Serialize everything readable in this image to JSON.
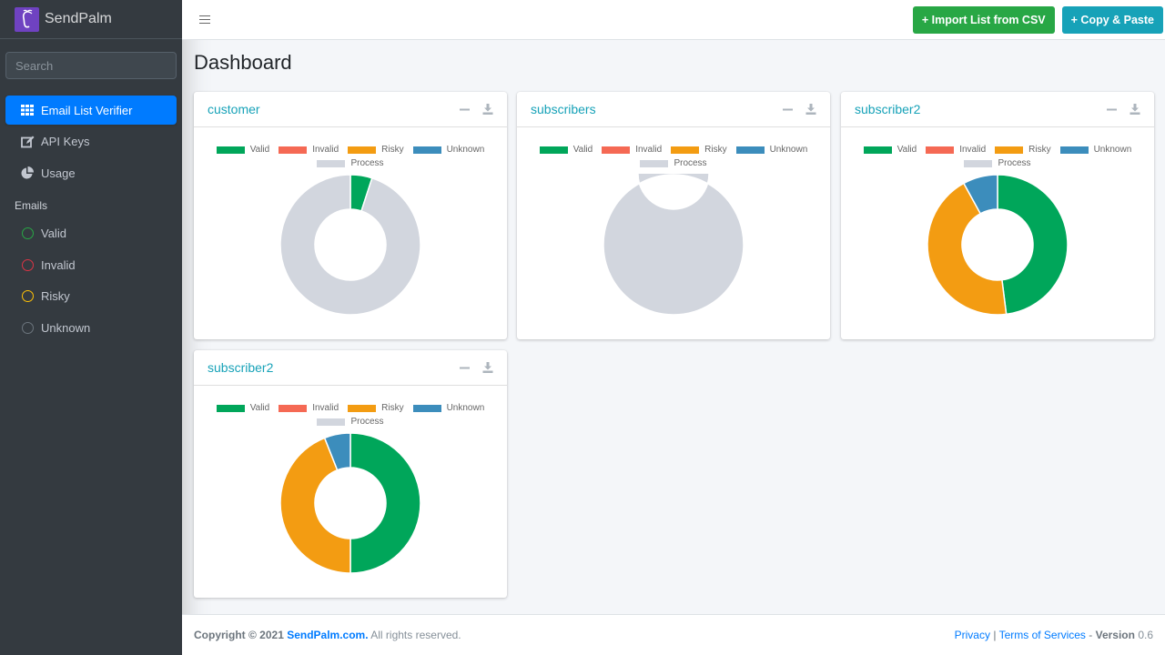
{
  "brand": {
    "name": "SendPalm",
    "logo_icon": "palm-logo-icon"
  },
  "search": {
    "placeholder": "Search",
    "value": ""
  },
  "sidebar": {
    "items": [
      {
        "label": "Email List Verifier",
        "icon": "grid-icon",
        "active": true
      },
      {
        "label": "API Keys",
        "icon": "edit-icon",
        "active": false
      },
      {
        "label": "Usage",
        "icon": "pie-chart-icon",
        "active": false
      }
    ],
    "section_header": "Emails",
    "email_items": [
      {
        "label": "Valid",
        "color": "#28a745"
      },
      {
        "label": "Invalid",
        "color": "#dc3545"
      },
      {
        "label": "Risky",
        "color": "#ffc107"
      },
      {
        "label": "Unknown",
        "color": "#6c757d"
      }
    ]
  },
  "topbar": {
    "import_label": "+ Import List from CSV",
    "copy_paste_label": "+ Copy & Paste"
  },
  "page": {
    "title": "Dashboard"
  },
  "legend": {
    "labels": [
      "Valid",
      "Invalid",
      "Risky",
      "Unknown",
      "Process"
    ],
    "colors": [
      "#00a65a",
      "#f56954",
      "#f39c12",
      "#3c8dbc",
      "#d2d6de"
    ]
  },
  "cards": [
    {
      "title": "customer"
    },
    {
      "title": "subscribers"
    },
    {
      "title": "subscriber2"
    },
    {
      "title": "subscriber2"
    }
  ],
  "chart_data": [
    {
      "type": "pie",
      "variant": "doughnut",
      "title": "customer",
      "labels": [
        "Valid",
        "Invalid",
        "Risky",
        "Unknown",
        "Process"
      ],
      "values": [
        5,
        0,
        0,
        0,
        95
      ]
    },
    {
      "type": "pie",
      "variant": "doughnut",
      "title": "subscribers",
      "labels": [
        "Valid",
        "Invalid",
        "Risky",
        "Unknown",
        "Process"
      ],
      "values": [
        0,
        0,
        0,
        0,
        100
      ]
    },
    {
      "type": "pie",
      "variant": "doughnut",
      "title": "subscriber2",
      "labels": [
        "Valid",
        "Invalid",
        "Risky",
        "Unknown",
        "Process"
      ],
      "values": [
        48,
        0,
        44,
        8,
        0
      ]
    },
    {
      "type": "pie",
      "variant": "doughnut",
      "title": "subscriber2",
      "labels": [
        "Valid",
        "Invalid",
        "Risky",
        "Unknown",
        "Process"
      ],
      "values": [
        50,
        0,
        44,
        6,
        0
      ]
    }
  ],
  "footer": {
    "copyright_prefix": "Copyright © 2021 ",
    "site_link": "SendPalm.com.",
    "rights": " All rights reserved.",
    "privacy": "Privacy",
    "separator": "|",
    "terms": "Terms of Services",
    "version_label": "Version",
    "version_value": "0.6",
    "dash": " - "
  }
}
